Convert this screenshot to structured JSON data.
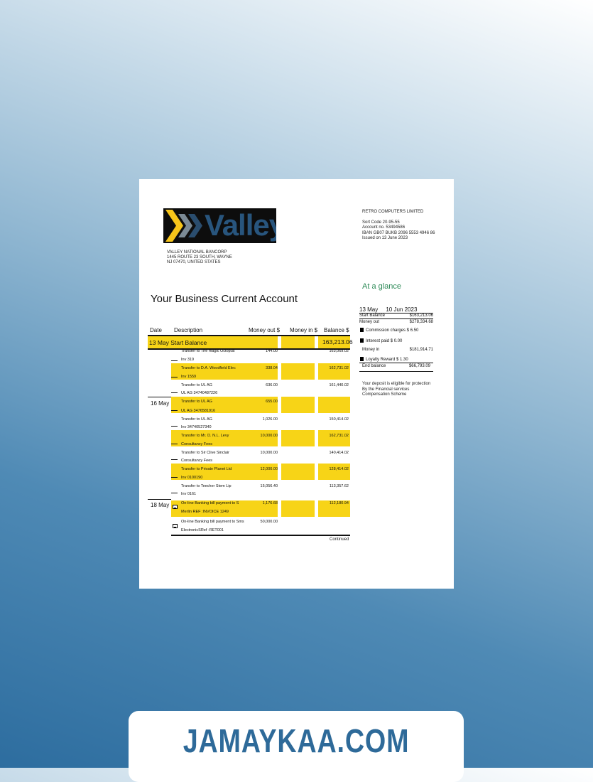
{
  "brand": {
    "logo_text": "Valley",
    "colors": {
      "accent_yellow": "#f7d417",
      "footer_text": "#2e6a99",
      "glance_green": "#2d8a57"
    }
  },
  "bank_address": [
    "VALLEY NATIONAL BANCORP",
    "1445 ROUTE 23 SOUTH, WAYNE",
    "NJ 07470, UNITED STATES"
  ],
  "customer": {
    "name": "RETRO COMPUTERS LIMITED",
    "sort_code": "Sort Code 20-95-55",
    "account_no": "Account no. 53494586",
    "iban": "IBAN GB07 BUKB 2096 5553 4946 86",
    "issued": "Issued on 13 June 2023"
  },
  "title": "Your Business Current Account",
  "glance": {
    "heading": "At a glance",
    "period_from": "13 May",
    "period_to": "10 Jun 2023",
    "rows": [
      {
        "label": "Start Balance",
        "value": "$163,213.06"
      },
      {
        "label": "Money out",
        "value": "$278,334.68"
      },
      {
        "label": "Commission charges $ 6.50",
        "value": ""
      },
      {
        "label": "Interest paid $ 0.00",
        "value": ""
      },
      {
        "label": "Money in",
        "value": "$181,914.71"
      },
      {
        "label": "Loyalty Reward $ 1.30",
        "value": ""
      },
      {
        "label": "End balance",
        "value": "$66,793.09"
      }
    ],
    "protection": [
      "Your deposit is eligible for protection",
      "By the Financial services",
      "Compensation Scheme"
    ]
  },
  "table": {
    "headers": {
      "date": "Date",
      "description": "Description",
      "money_out": "Money out $",
      "money_in": "Money in $",
      "balance": "Balance $"
    },
    "start_balance_label": "13 May Start Balance",
    "start_balance_value": "163,213.06",
    "dates": {
      "d16": "16 May",
      "d18": "18 May"
    },
    "rows": [
      {
        "l1": "Transfer to The magic Octopus",
        "l2": "Inv 319",
        "out": "144.00",
        "bal": "163,069.02"
      },
      {
        "l1": "Transfer to D.A. Woodfield Elec",
        "l2": "Inv 1559",
        "out": "338.04",
        "bal": "162,731.02"
      },
      {
        "l1": "Transfer to UL AG",
        "l2": "UL AG 34740487226",
        "out": "636.00",
        "bal": "161,440.02"
      },
      {
        "l1": "Transfer to UL AG",
        "l2": "UL AG 3476581916",
        "out": "655.00",
        "bal": ""
      },
      {
        "l1": "Transfer to UL AG",
        "l2": "Inv 34740527340",
        "out": "1,026.00",
        "bal": "150,414.02"
      },
      {
        "l1": "Transfer to Mr. D. N.L. Levy",
        "l2": "Consultancy Fees",
        "out": "10,000.00",
        "bal": "162,731.02"
      },
      {
        "l1": "Transfer to Sir Clive Sinclair",
        "l2": "Consultancy Fees",
        "out": "10,000.00",
        "bal": "140,414.02"
      },
      {
        "l1": "Transfer to Private Planet Ltd",
        "l2": "Inv 0100190",
        "out": "12,000.00",
        "bal": "128,414.02"
      },
      {
        "l1": "Transfer to Teecher Stem Lip",
        "l2": "Inv 0161",
        "out": "15,056.40",
        "bal": "113,357.62"
      },
      {
        "l1": "On-line Banking bill payment to S",
        "l2": "Merlin REF :INVOICE 1249",
        "out": "1,176.68",
        "bal": "112,180.94"
      },
      {
        "l1": "On-line Banking bill payment to Sms",
        "l2": "ElectronicSRef -RET001",
        "out": "50,000.00",
        "bal": ""
      }
    ],
    "continued": "Continued"
  },
  "footer": {
    "text": "JAMAYKAA.COM"
  }
}
